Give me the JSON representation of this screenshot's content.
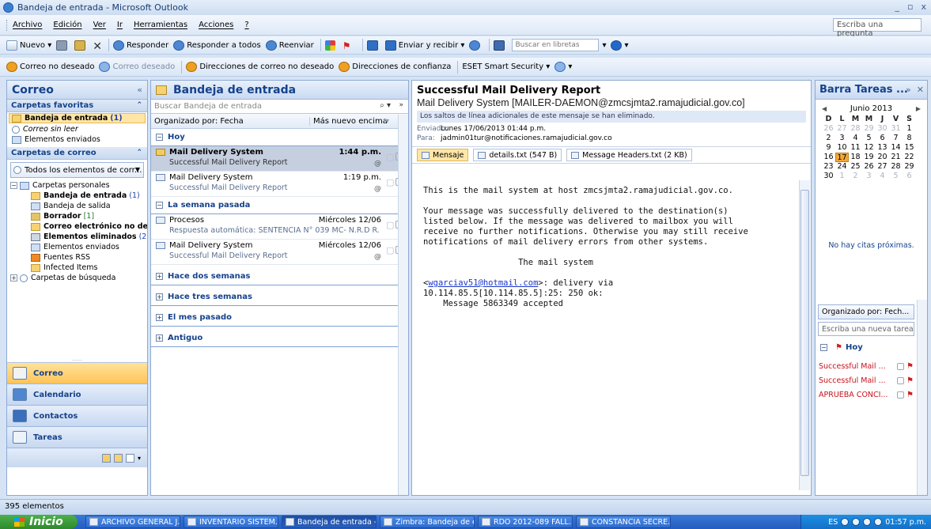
{
  "window": {
    "title": "Bandeja de entrada - Microsoft Outlook"
  },
  "menu": {
    "items": [
      "Archivo",
      "Edición",
      "Ver",
      "Ir",
      "Herramientas",
      "Acciones",
      "?"
    ],
    "ask_placeholder": "Escriba una pregunta"
  },
  "toolbar1": {
    "new": "Nuevo",
    "reply": "Responder",
    "reply_all": "Responder a todos",
    "forward": "Reenviar",
    "send_receive": "Enviar y recibir",
    "search_books_placeholder": "Buscar en libretas"
  },
  "toolbar2": {
    "junk": "Correo no deseado",
    "not_junk": "Correo deseado",
    "block_addr": "Direcciones de correo no deseado",
    "safe_addr": "Direcciones de confianza",
    "eset": "ESET Smart Security"
  },
  "nav": {
    "title": "Correo",
    "favorites_header": "Carpetas favoritas",
    "favorites": [
      {
        "label": "Bandeja de entrada",
        "count": "(1)"
      },
      {
        "label": "Correo sin leer"
      },
      {
        "label": "Elementos enviados"
      }
    ],
    "mail_folders_header": "Carpetas de correo",
    "all_items": "Todos los elementos de corr...",
    "personal_folders": "Carpetas personales",
    "folders": [
      {
        "label": "Bandeja de entrada",
        "count": "(1)"
      },
      {
        "label": "Bandeja de salida"
      },
      {
        "label": "Borrador",
        "count": "[1]"
      },
      {
        "label": "Correo electrónico no desea"
      },
      {
        "label": "Elementos eliminados",
        "count": "(2)"
      },
      {
        "label": "Elementos enviados"
      },
      {
        "label": "Fuentes RSS"
      },
      {
        "label": "Infected Items"
      }
    ],
    "search_folders": "Carpetas de búsqueda",
    "buttons": [
      "Correo",
      "Calendario",
      "Contactos",
      "Tareas"
    ]
  },
  "list": {
    "title": "Bandeja de entrada",
    "search_placeholder": "Buscar Bandeja de entrada",
    "arranged_by": "Organizado por: Fecha",
    "order": "Más nuevo encima",
    "groups": {
      "today": "Hoy",
      "last_week": "La semana pasada",
      "two_weeks": "Hace dos semanas",
      "three_weeks": "Hace tres semanas",
      "last_month": "El mes pasado",
      "older": "Antiguo"
    },
    "messages": [
      {
        "from": "Mail Delivery System",
        "date": "1:44 p.m.",
        "subject": "Successful Mail Delivery Report"
      },
      {
        "from": "Mail Delivery System",
        "date": "1:19 p.m.",
        "subject": "Successful Mail Delivery Report"
      },
      {
        "from": "Procesos",
        "date": "Miércoles 12/06",
        "subject": "Respuesta automática: SENTENCIA N° 039 MC- N.R.D R..."
      },
      {
        "from": "Mail Delivery System",
        "date": "Miércoles 12/06",
        "subject": "Successful Mail Delivery Report"
      }
    ]
  },
  "reading": {
    "subject": "Successful Mail Delivery Report",
    "from": "Mail Delivery System [MAILER-DAEMON@zmcsjmta2.ramajudicial.gov.co]",
    "info": "Los saltos de línea adicionales de este mensaje se han eliminado.",
    "sent_label": "Enviado:",
    "sent": "Lunes 17/06/2013 01:44 p.m.",
    "to_label": "Para:",
    "to": "jadmin01tur@notificaciones.ramajudicial.gov.co",
    "tabs": [
      "Mensaje",
      "details.txt (547 B)",
      "Message Headers.txt (2 KB)"
    ],
    "body_p1": "This is the mail system at host zmcsjmta2.ramajudicial.gov.co.",
    "body_p2": "Your message was successfully delivered to the destination(s)\nlisted below. If the message was delivered to mailbox you will\nreceive no further notifications. Otherwise you may still receive\nnotifications of mail delivery errors from other systems.",
    "body_p3": "                   The mail system",
    "body_link": "wgarciav51@hotmail.com",
    "body_after_link": ">: delivery via",
    "body_p5": "10.114.85.5[10.114.85.5]:25: 250 ok:\n    Message 5863349 accepted"
  },
  "todo": {
    "title": "Barra Tareas ...",
    "month": "Junio 2013",
    "dow": [
      "D",
      "L",
      "M",
      "M",
      "J",
      "V",
      "S"
    ],
    "no_appointments": "No hay citas próximas.",
    "arranged_by": "Organizado por: Fech...",
    "new_task_placeholder": "Escriba una nueva tarea",
    "group": "Hoy",
    "tasks": [
      "Successful Mail ...",
      "Successful Mail ...",
      "APRUEBA CONCI..."
    ]
  },
  "status": {
    "items": "395 elementos"
  },
  "taskbar": {
    "start": "Inicio",
    "buttons": [
      "ARCHIVO GENERAL J...",
      "INVENTARIO SISTEM...",
      "Bandeja de entrada -...",
      "Zimbra: Bandeja de e...",
      "RDO 2012-089 FALL...",
      "CONSTANCIA SECRE..."
    ],
    "lang": "ES",
    "clock": "01:57 p.m."
  },
  "colors": {
    "accent": "#15428b",
    "selected": "#ffe6a6",
    "task_red": "#c8101c"
  }
}
